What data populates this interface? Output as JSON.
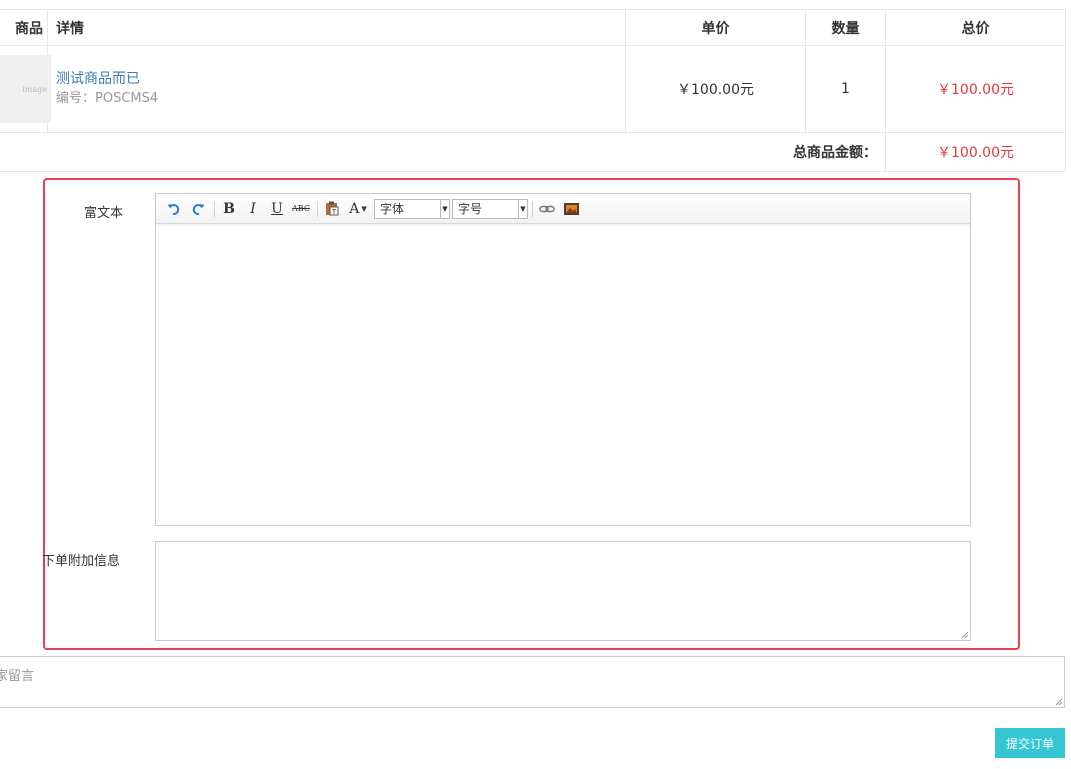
{
  "table": {
    "headers": {
      "goods": "商品",
      "detail": "详情",
      "unit_price": "单价",
      "quantity": "数量",
      "total": "总价"
    },
    "rows": [
      {
        "thumb_text": "image",
        "name": "测试商品而已",
        "sku": "编号：POSCMS4",
        "unit_price": "￥100.00元",
        "quantity": "1",
        "total": "￥100.00元"
      }
    ],
    "summary_label": "总商品金额：",
    "summary_value": "￥100.00元"
  },
  "form": {
    "rich_text_label": "富文本",
    "extra_info_label": "下单附加信息",
    "toolbar": {
      "undo_icon": "undo-icon",
      "redo_icon": "redo-icon",
      "bold": "B",
      "italic": "I",
      "underline": "U",
      "strike": "ABC",
      "font_color": "A",
      "font_family": "字体",
      "font_size": "字号"
    }
  },
  "buyer_message_placeholder": "家留言",
  "submit_label": "提交订单",
  "colors": {
    "accent": "#36c6d3",
    "price": "#e4393c",
    "link": "#3a7ab9",
    "highlight": "#e8414f"
  }
}
